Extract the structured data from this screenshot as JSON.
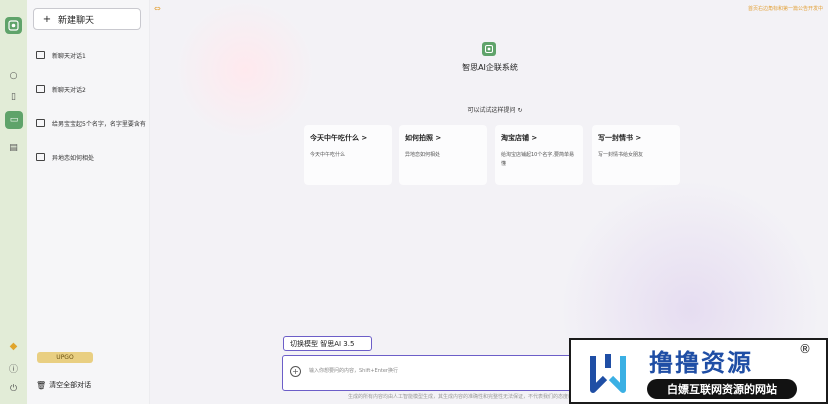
{
  "rail": {
    "icons": [
      "app-logo",
      "chat-icon",
      "image-icon",
      "active-chat-icon",
      "document-icon",
      "vip-icon",
      "info-icon",
      "power-icon"
    ]
  },
  "sidebar": {
    "new_chat_label": "新建聊天",
    "conversations": [
      {
        "title": "新聊天对话1"
      },
      {
        "title": "新聊天对话2"
      },
      {
        "title": "给男宝宝起5个名字，名字里要含有"
      },
      {
        "title": "异地恋如何相处"
      }
    ],
    "upgrade_label": "UPGO",
    "clear_label": "清空全部对话"
  },
  "main": {
    "notice": "首页右边角标和第一篇公告开发中",
    "brand_title": "智思AI企联系统",
    "try_label": "可以试试这样提问",
    "cards": [
      {
        "title": "今天中午吃什么 >",
        "desc": "今天中午吃什么"
      },
      {
        "title": "如何拍照 >",
        "desc": "异地恋如何相处"
      },
      {
        "title": "淘宝店铺 >",
        "desc": "给淘宝店铺起10个名字,要简单易懂"
      },
      {
        "title": "写一封情书 >",
        "desc": "写一封情书给女朋友"
      }
    ],
    "model_label": "切换模型 智思AI 3.5",
    "input_placeholder": "输入你想要问的内容，Shift+Enter换行",
    "footer_text": "生成的所有内容均由人工智能模型生成，其生成内容的准确性和完整性无法保证，不代表我们的态度或观点"
  },
  "watermark": {
    "title": "撸撸资源",
    "reg_mark": "®",
    "subtitle": "白嫖互联网资源的网站"
  },
  "colors": {
    "accent": "#6c5ec8",
    "brand_green": "#5fa36a",
    "gold": "#e3a23a",
    "watermark_blue": "#1f4ea5"
  }
}
